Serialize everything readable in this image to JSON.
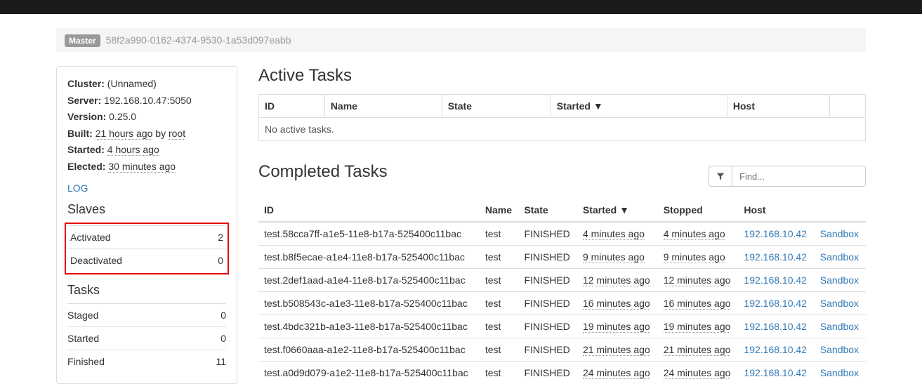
{
  "master": {
    "badge": "Master",
    "id": "58f2a990-0162-4374-9530-1a53d097eabb"
  },
  "info": {
    "cluster_label": "Cluster:",
    "cluster_value": "(Unnamed)",
    "server_label": "Server:",
    "server_value": "192.168.10.47:5050",
    "version_label": "Version:",
    "version_value": "0.25.0",
    "built_label": "Built:",
    "built_value": "21 hours ago",
    "built_by_text": "by",
    "built_by_value": "root",
    "started_label": "Started:",
    "started_value": "4 hours ago",
    "elected_label": "Elected:",
    "elected_value": "30 minutes ago"
  },
  "log_link": "LOG",
  "slaves": {
    "heading": "Slaves",
    "rows": [
      {
        "label": "Activated",
        "value": "2"
      },
      {
        "label": "Deactivated",
        "value": "0"
      }
    ]
  },
  "tasks": {
    "heading": "Tasks",
    "rows": [
      {
        "label": "Staged",
        "value": "0"
      },
      {
        "label": "Started",
        "value": "0"
      },
      {
        "label": "Finished",
        "value": "11"
      }
    ]
  },
  "active": {
    "heading": "Active Tasks",
    "columns": {
      "id": "ID",
      "name": "Name",
      "state": "State",
      "started": "Started ▼",
      "host": "Host"
    },
    "empty": "No active tasks."
  },
  "completed": {
    "heading": "Completed Tasks",
    "filter_placeholder": "Find...",
    "columns": {
      "id": "ID",
      "name": "Name",
      "state": "State",
      "started": "Started ▼",
      "stopped": "Stopped",
      "host": "Host",
      "sandbox": ""
    },
    "rows": [
      {
        "id": "test.58cca7ff-a1e5-11e8-b17a-525400c11bac",
        "name": "test",
        "state": "FINISHED",
        "started": "4 minutes ago",
        "stopped": "4 minutes ago",
        "host": "192.168.10.42",
        "sandbox": "Sandbox"
      },
      {
        "id": "test.b8f5ecae-a1e4-11e8-b17a-525400c11bac",
        "name": "test",
        "state": "FINISHED",
        "started": "9 minutes ago",
        "stopped": "9 minutes ago",
        "host": "192.168.10.42",
        "sandbox": "Sandbox"
      },
      {
        "id": "test.2def1aad-a1e4-11e8-b17a-525400c11bac",
        "name": "test",
        "state": "FINISHED",
        "started": "12 minutes ago",
        "stopped": "12 minutes ago",
        "host": "192.168.10.42",
        "sandbox": "Sandbox"
      },
      {
        "id": "test.b508543c-a1e3-11e8-b17a-525400c11bac",
        "name": "test",
        "state": "FINISHED",
        "started": "16 minutes ago",
        "stopped": "16 minutes ago",
        "host": "192.168.10.42",
        "sandbox": "Sandbox"
      },
      {
        "id": "test.4bdc321b-a1e3-11e8-b17a-525400c11bac",
        "name": "test",
        "state": "FINISHED",
        "started": "19 minutes ago",
        "stopped": "19 minutes ago",
        "host": "192.168.10.42",
        "sandbox": "Sandbox"
      },
      {
        "id": "test.f0660aaa-a1e2-11e8-b17a-525400c11bac",
        "name": "test",
        "state": "FINISHED",
        "started": "21 minutes ago",
        "stopped": "21 minutes ago",
        "host": "192.168.10.42",
        "sandbox": "Sandbox"
      },
      {
        "id": "test.a0d9d079-a1e2-11e8-b17a-525400c11bac",
        "name": "test",
        "state": "FINISHED",
        "started": "24 minutes ago",
        "stopped": "24 minutes ago",
        "host": "192.168.10.42",
        "sandbox": "Sandbox"
      }
    ]
  }
}
